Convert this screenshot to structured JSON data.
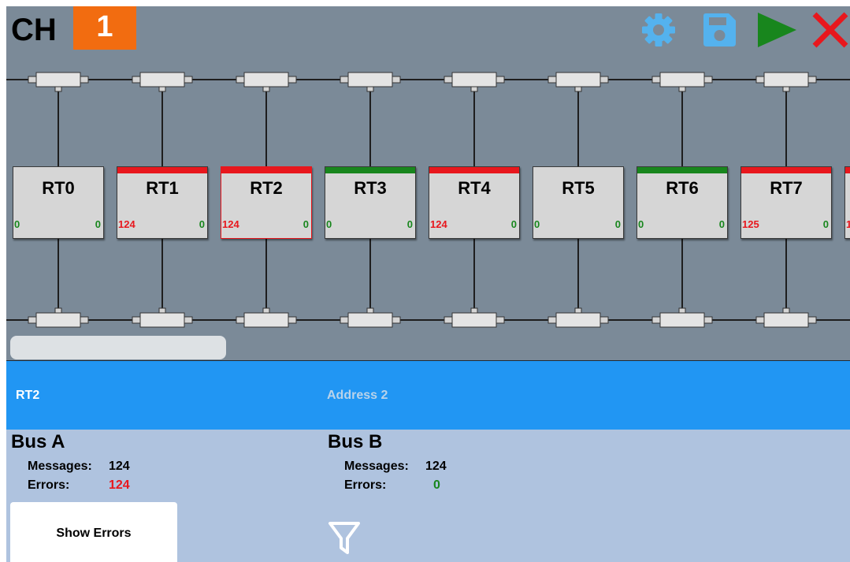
{
  "header": {
    "channel_label": "CH",
    "channel_number": "1",
    "tools": [
      "gear-icon",
      "save-icon",
      "play-icon",
      "close-icon"
    ]
  },
  "colors": {
    "bus_background": "#7b8a98",
    "channel_badge": "#f26c10",
    "error": "#e8171d",
    "ok": "#18861d",
    "selection": "#2196f3",
    "details": "#afc3df"
  },
  "terminals": [
    {
      "name": "RT0",
      "status": "none",
      "count_a": "0",
      "count_a_status": "ok",
      "count_b": "0",
      "count_b_status": "ok"
    },
    {
      "name": "RT1",
      "status": "error",
      "count_a": "124",
      "count_a_status": "error",
      "count_b": "0",
      "count_b_status": "ok"
    },
    {
      "name": "RT2",
      "status": "error",
      "count_a": "124",
      "count_a_status": "error",
      "count_b": "0",
      "count_b_status": "ok"
    },
    {
      "name": "RT3",
      "status": "ok",
      "count_a": "0",
      "count_a_status": "ok",
      "count_b": "0",
      "count_b_status": "ok"
    },
    {
      "name": "RT4",
      "status": "error",
      "count_a": "124",
      "count_a_status": "error",
      "count_b": "0",
      "count_b_status": "ok"
    },
    {
      "name": "RT5",
      "status": "none",
      "count_a": "0",
      "count_a_status": "ok",
      "count_b": "0",
      "count_b_status": "ok"
    },
    {
      "name": "RT6",
      "status": "ok",
      "count_a": "0",
      "count_a_status": "ok",
      "count_b": "0",
      "count_b_status": "ok"
    },
    {
      "name": "RT7",
      "status": "error",
      "count_a": "125",
      "count_a_status": "error",
      "count_b": "0",
      "count_b_status": "ok"
    },
    {
      "name": "",
      "status": "error",
      "count_a": "1",
      "count_a_status": "error",
      "count_b": "",
      "count_b_status": "ok"
    }
  ],
  "selected": {
    "name": "RT2",
    "address": "Address 2"
  },
  "bus_a": {
    "title": "Bus A",
    "messages_label": "Messages:",
    "messages_value": "124",
    "errors_label": "Errors:",
    "errors_value": "124"
  },
  "bus_b": {
    "title": "Bus B",
    "messages_label": "Messages:",
    "messages_value": "124",
    "errors_label": "Errors:",
    "errors_value": "0"
  },
  "actions": {
    "show_errors_label": "Show Errors",
    "filter_icon": "filter-icon"
  }
}
